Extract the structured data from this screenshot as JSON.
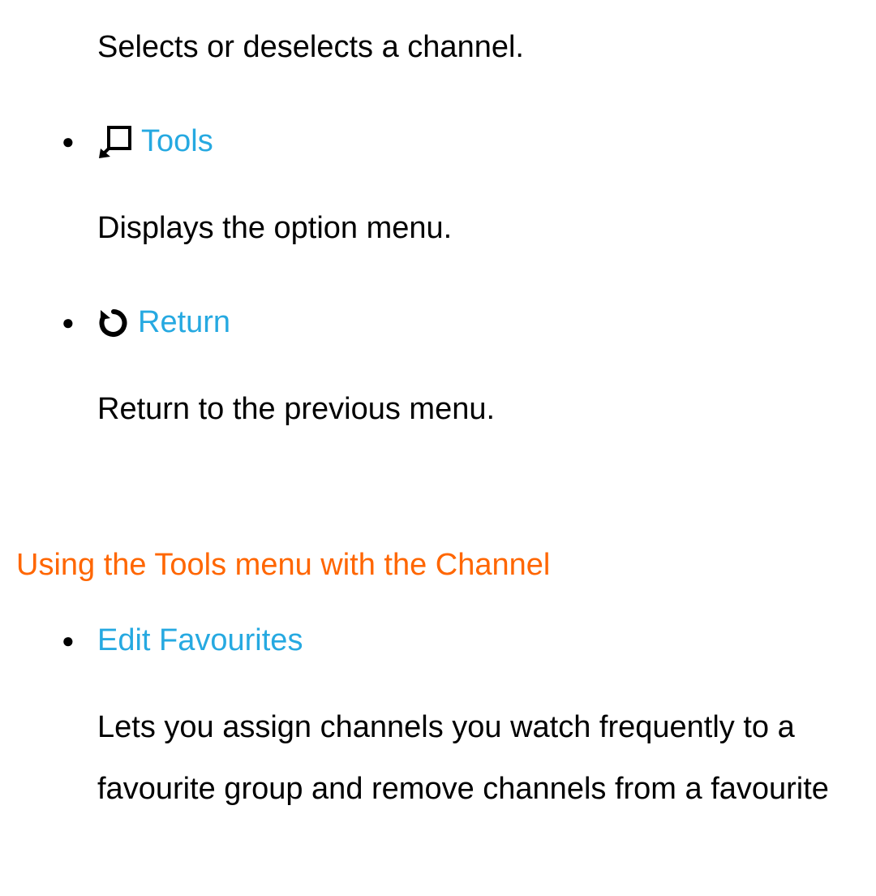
{
  "intro_desc": "Selects or deselects a channel.",
  "items": [
    {
      "label": "Tools",
      "desc": "Displays the option menu."
    },
    {
      "label": "Return",
      "desc": "Return to the previous menu."
    }
  ],
  "section": {
    "heading": "Using the Tools menu with the Channel",
    "items": [
      {
        "label": "Edit Favourites",
        "desc": "Lets you assign channels you watch frequently to a favourite group and remove channels from a favourite"
      }
    ]
  }
}
